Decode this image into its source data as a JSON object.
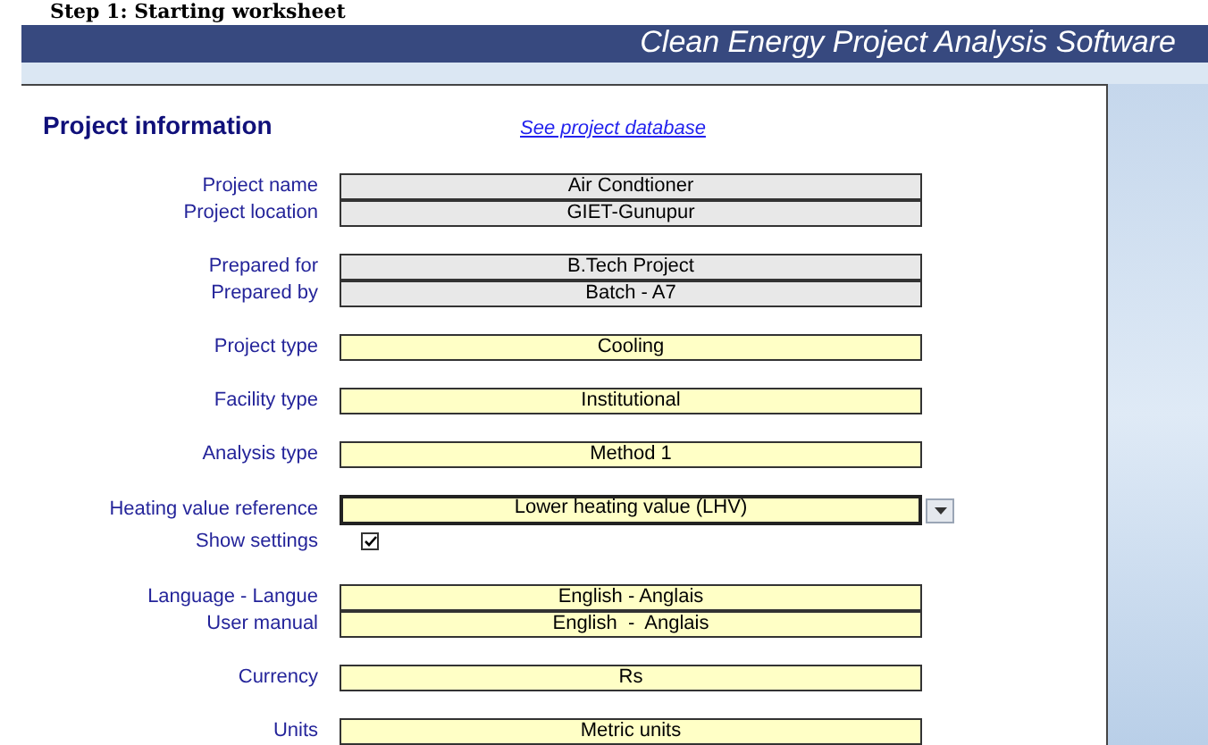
{
  "page_heading": "Step 1: Starting worksheet",
  "banner": {
    "title": "Clean Energy Project Analysis Software"
  },
  "section": {
    "title": "Project information",
    "link": "See project database"
  },
  "groups": [
    {
      "rows": [
        {
          "kind": "gray",
          "label": "Project name",
          "value": "Air Condtioner"
        },
        {
          "kind": "gray",
          "label": "Project location",
          "value": "GIET-Gunupur"
        }
      ]
    },
    {
      "rows": [
        {
          "kind": "gray",
          "label": "Prepared for",
          "value": "B.Tech Project"
        },
        {
          "kind": "gray",
          "label": "Prepared by",
          "value": "Batch - A7"
        }
      ]
    },
    {
      "rows": [
        {
          "kind": "input",
          "label": "Project type",
          "value": "Cooling"
        }
      ]
    },
    {
      "rows": [
        {
          "kind": "input",
          "label": "Facility type",
          "value": "Institutional"
        }
      ]
    },
    {
      "rows": [
        {
          "kind": "input",
          "label": "Analysis type",
          "value": "Method 1"
        }
      ]
    },
    {
      "rows": [
        {
          "kind": "dropdown",
          "label": "Heating value reference",
          "value": "Lower heating value (LHV)"
        },
        {
          "kind": "checkbox",
          "label": "Show settings",
          "checked": true
        }
      ]
    },
    {
      "rows": [
        {
          "kind": "input",
          "label": "Language - Langue",
          "value": "English - Anglais"
        },
        {
          "kind": "input",
          "label": "User manual",
          "value": "English  -  Anglais"
        }
      ]
    },
    {
      "rows": [
        {
          "kind": "input",
          "label": "Currency",
          "value": "Rs"
        }
      ]
    },
    {
      "rows": [
        {
          "kind": "input",
          "label": "Units",
          "value": "Metric units"
        }
      ]
    }
  ]
}
